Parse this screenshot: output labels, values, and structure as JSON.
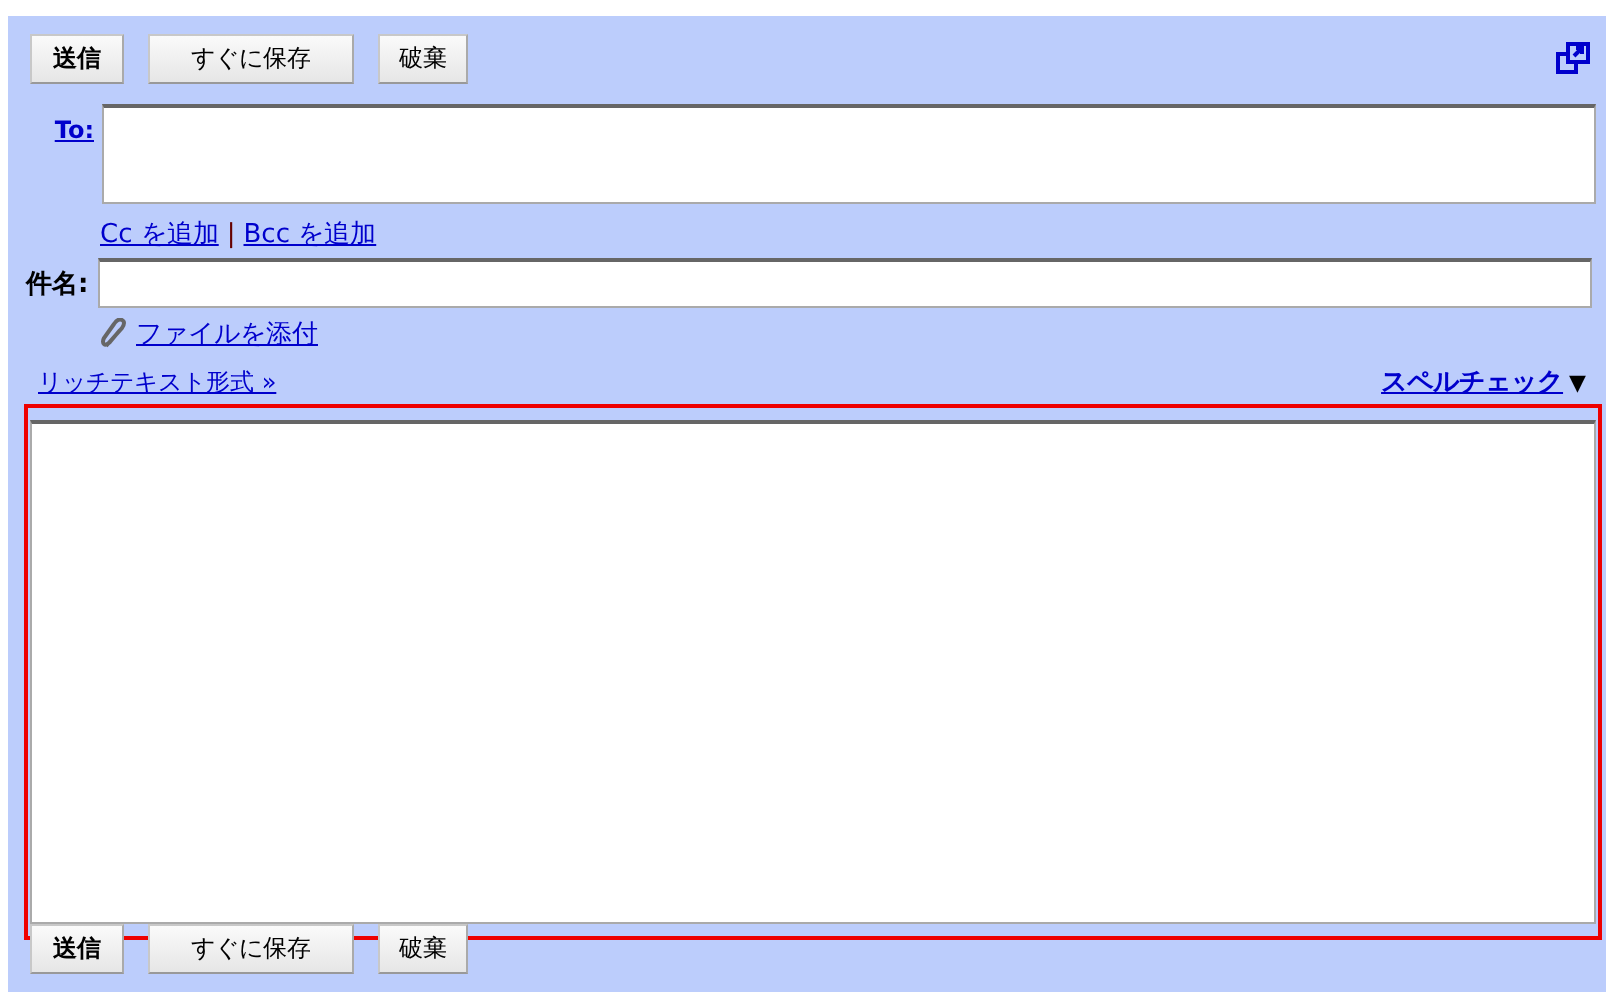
{
  "top_buttons": [
    {
      "label": "送信",
      "kind": "primary"
    },
    {
      "label": "すぐに保存",
      "kind": "normal"
    },
    {
      "label": "破棄",
      "kind": "normal"
    }
  ],
  "to": {
    "label": "To:"
  },
  "cc_links": {
    "cc": "Cc を追加",
    "separator": "|",
    "bcc": "Bcc を追加"
  },
  "subject": {
    "label": "件名:"
  },
  "attach": {
    "label": "ファイルを添付"
  },
  "rich_text": "リッチテキスト形式 »",
  "spell_check": {
    "label": "スペルチェック",
    "arrow": "▼"
  },
  "bottom_buttons": [
    {
      "label": "送信",
      "kind": "primary"
    },
    {
      "label": "すぐに保存",
      "kind": "normal"
    },
    {
      "label": "破棄",
      "kind": "normal"
    }
  ]
}
